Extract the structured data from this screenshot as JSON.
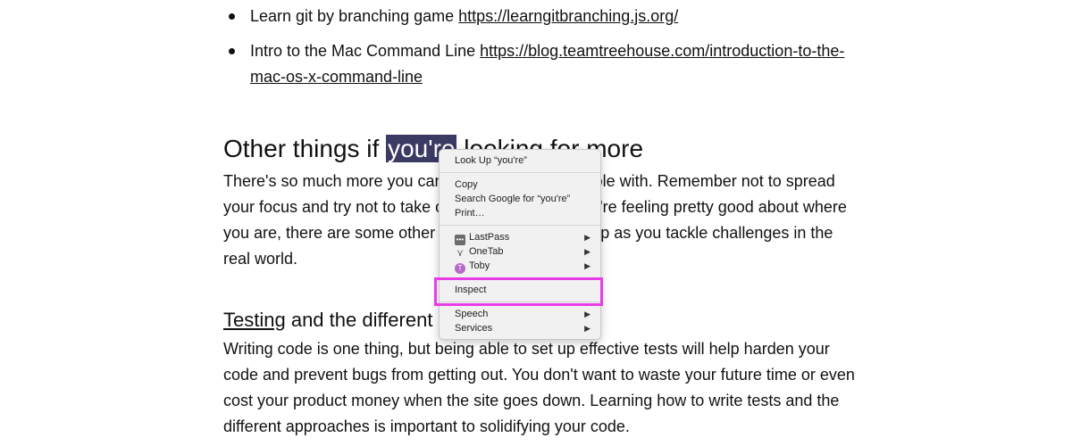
{
  "bullets": [
    {
      "text": "Learn git by branching game ",
      "link": "https://learngitbranching.js.org/"
    },
    {
      "text": "Intro to the Mac Command Line ",
      "link": "https://blog.teamtreehouse.com/introduction-to-the-mac-os-x-command-line"
    }
  ],
  "section1": {
    "heading_before": "Other things if ",
    "heading_selected": "you're",
    "heading_after": " looking for more",
    "paragraph": "There's so much more you can go down the rabbit hole with. Remember not to spread your focus and try not to take on too much. But if you're feeling pretty good about where you are, there are some other things that will only help as you tackle challenges in the real world."
  },
  "section2": {
    "heading_link": "Testing",
    "heading_after": " and the different approaches",
    "paragraph": "Writing code is one thing, but being able to set up effective tests will help harden your code and prevent bugs from getting out. You don't want to waste your future time or even cost your product money when the site goes down. Learning how to write tests and the different approaches is important to solidifying your code."
  },
  "context_menu": {
    "lookup": "Look Up “you're”",
    "copy": "Copy",
    "search": "Search Google for “you're”",
    "print": "Print…",
    "lastpass": "LastPass",
    "onetab": "OneTab",
    "toby": "Toby",
    "inspect": "Inspect",
    "speech": "Speech",
    "services": "Services",
    "submenu_arrow": "▶",
    "lastpass_icon": "•••",
    "onetab_icon": "⋎",
    "toby_icon": "T"
  },
  "colors": {
    "selection": "#3b3a63",
    "highlight_box": "#e83ce8"
  }
}
